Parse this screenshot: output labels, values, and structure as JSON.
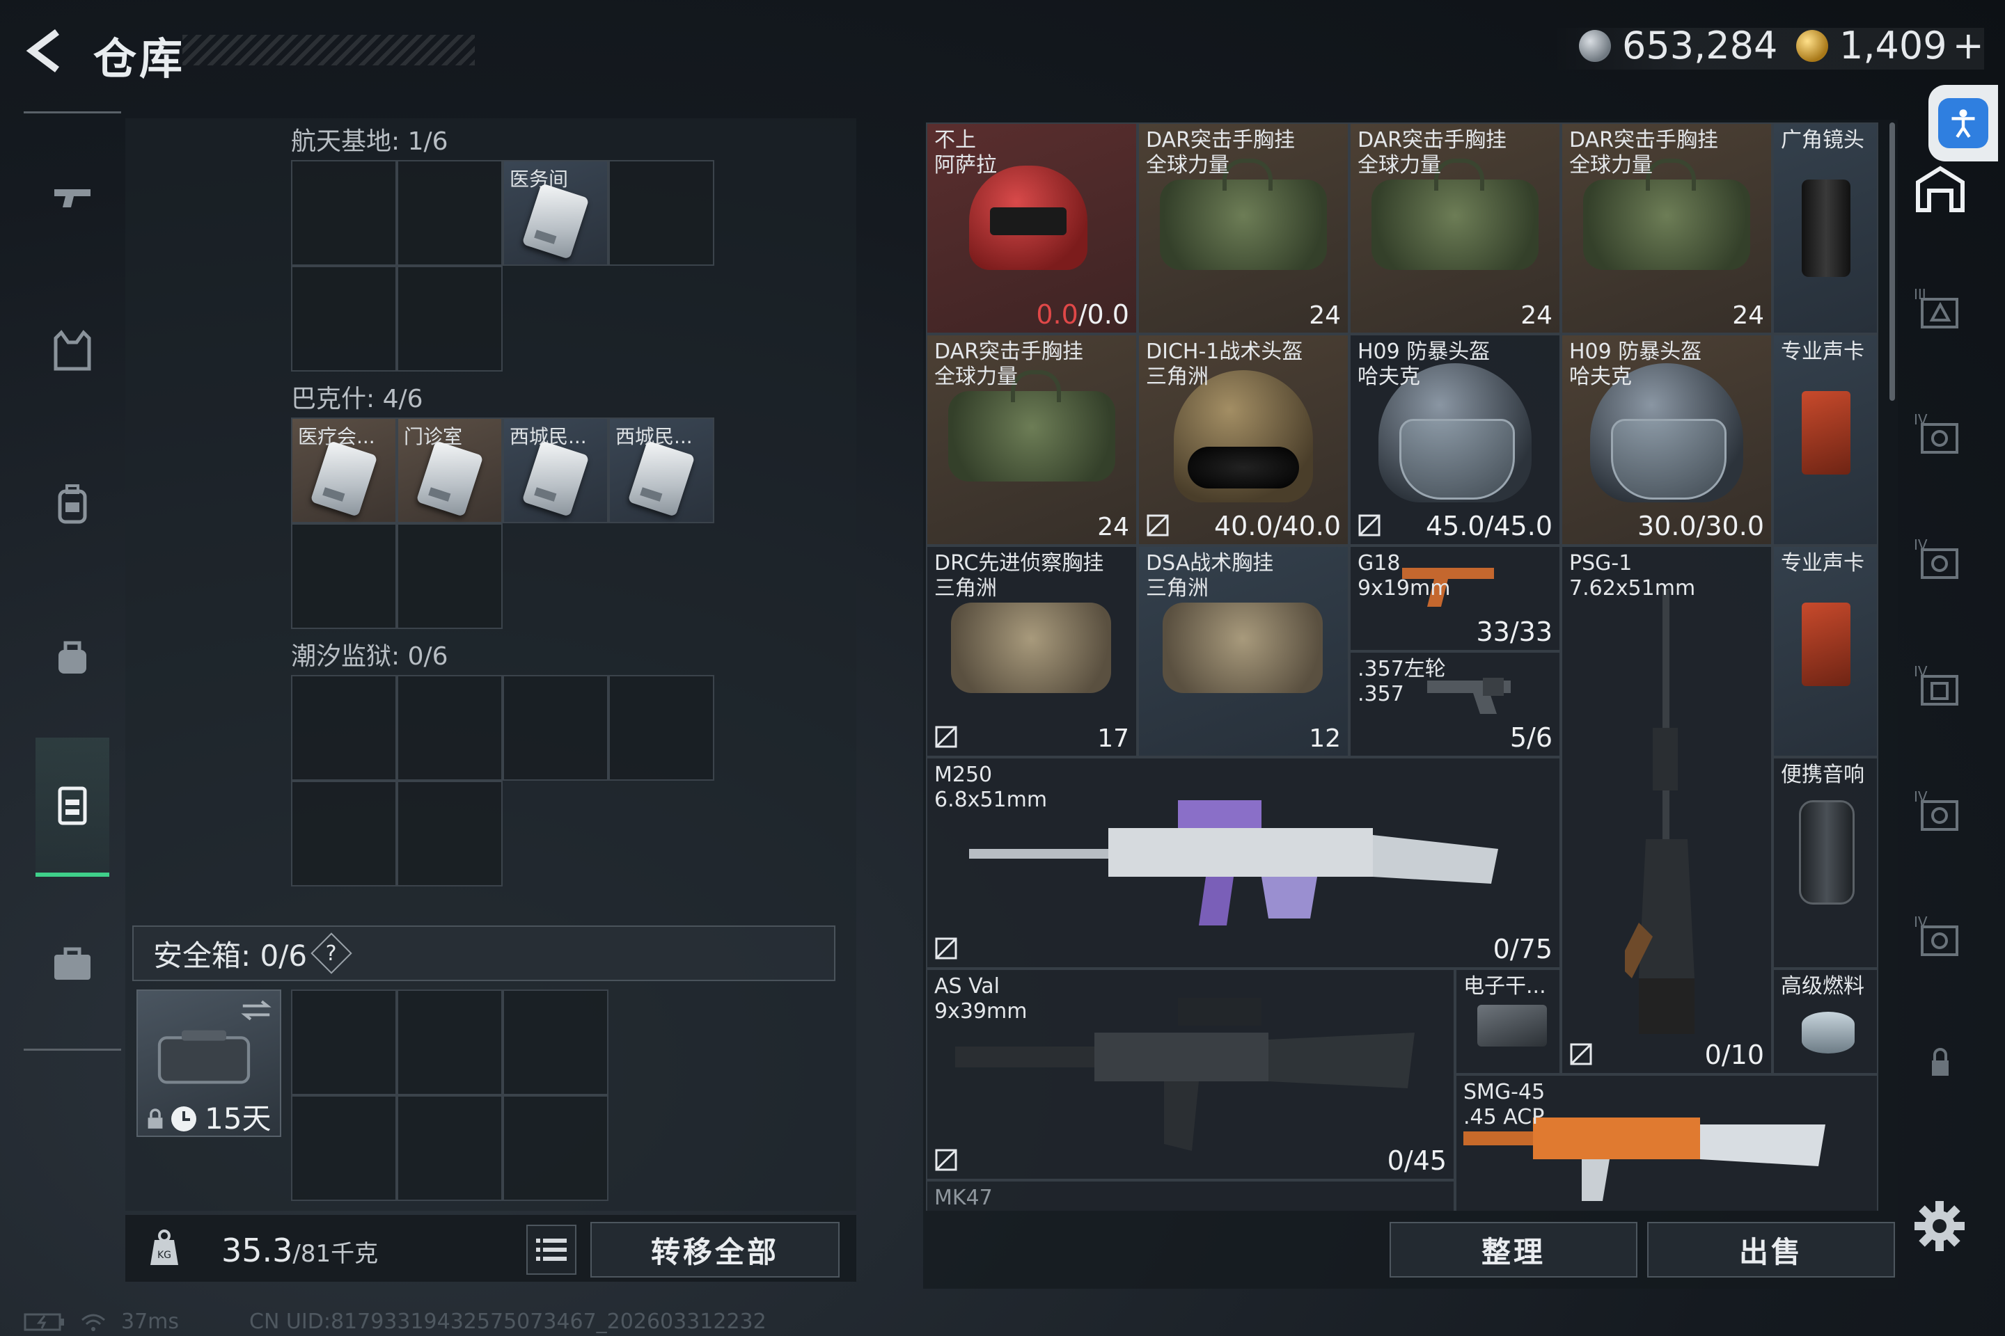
{
  "header": {
    "title": "仓库",
    "currency_silver": "653,284",
    "currency_gold": "1,409",
    "currency_gold_add": "+"
  },
  "nav": {
    "items": [
      {
        "name": "weapons",
        "icon": "pistol-icon"
      },
      {
        "name": "armor",
        "icon": "vest-icon"
      },
      {
        "name": "backpack",
        "icon": "backpack-icon"
      },
      {
        "name": "bag",
        "icon": "bag-icon"
      },
      {
        "name": "storage",
        "icon": "storage-icon",
        "active": true
      },
      {
        "name": "case",
        "icon": "briefcase-icon"
      }
    ]
  },
  "left": {
    "section1": "航天基地: 1/6",
    "section1_item": "医务间",
    "section2": "巴克什: 4/6",
    "section2_items": [
      "医疗会...",
      "门诊室",
      "西城民...",
      "西城民..."
    ],
    "section3": "潮汐监狱: 0/6",
    "safe_label": "安全箱: 0/6",
    "safe_help": "?",
    "safe_days": "15天",
    "weight_value": "35.3",
    "weight_unit": "/81千克",
    "transfer_all": "转移全部"
  },
  "inventory": {
    "items": [
      {
        "id": "helmet-red",
        "name": "不上\n阿萨拉",
        "value_red": "0.0",
        "value_rest": "/0.0"
      },
      {
        "id": "vest1",
        "name": "DAR突击手胸挂\n全球力量",
        "cap": "24"
      },
      {
        "id": "vest2",
        "name": "DAR突击手胸挂\n全球力量",
        "cap": "24"
      },
      {
        "id": "vest3",
        "name": "DAR突击手胸挂\n全球力量",
        "cap": "24"
      },
      {
        "id": "lens",
        "name": "广角镜头"
      },
      {
        "id": "vest4",
        "name": "DAR突击手胸挂\n全球力量",
        "cap": "24"
      },
      {
        "id": "dich",
        "name": "DICH-1战术头盔\n三角洲",
        "value": "40.0/40.0"
      },
      {
        "id": "h09a",
        "name": "H09 防暴头盔\n哈夫克",
        "value": "45.0/45.0"
      },
      {
        "id": "h09b",
        "name": "H09 防暴头盔\n哈夫克",
        "value": "30.0/30.0"
      },
      {
        "id": "card1",
        "name": "专业声卡"
      },
      {
        "id": "drc",
        "name": "DRC先进侦察胸挂\n三角洲",
        "cap": "17"
      },
      {
        "id": "dsa",
        "name": "DSA战术胸挂\n三角洲",
        "cap": "12"
      },
      {
        "id": "g18",
        "name": "G18\n9x19mm",
        "value": "33/33"
      },
      {
        "id": "psg1",
        "name": "PSG-1\n7.62x51mm",
        "value": "0/10"
      },
      {
        "id": "card2",
        "name": "专业声卡"
      },
      {
        "id": "revolver",
        "name": ".357左轮\n.357",
        "value": "5/6"
      },
      {
        "id": "m250",
        "name": "M250\n6.8x51mm",
        "value": "0/75"
      },
      {
        "id": "speaker",
        "name": "便携音响"
      },
      {
        "id": "asval",
        "name": "AS Val\n9x39mm",
        "value": "0/45"
      },
      {
        "id": "device",
        "name": "电子干..."
      },
      {
        "id": "fuel",
        "name": "高级燃料"
      },
      {
        "id": "smg45",
        "name": "SMG-45\n.45 ACP"
      },
      {
        "id": "mk47",
        "name": "MK47"
      }
    ],
    "sort_label": "整理",
    "sell_label": "出售"
  },
  "status": {
    "ping": "37ms",
    "uid": "CN UID:817933194325750734​67_202603312232"
  },
  "colors": {
    "accent_green": "#3fd08a",
    "red_text": "#e04848",
    "accessibility_blue": "#2f7fe0"
  }
}
